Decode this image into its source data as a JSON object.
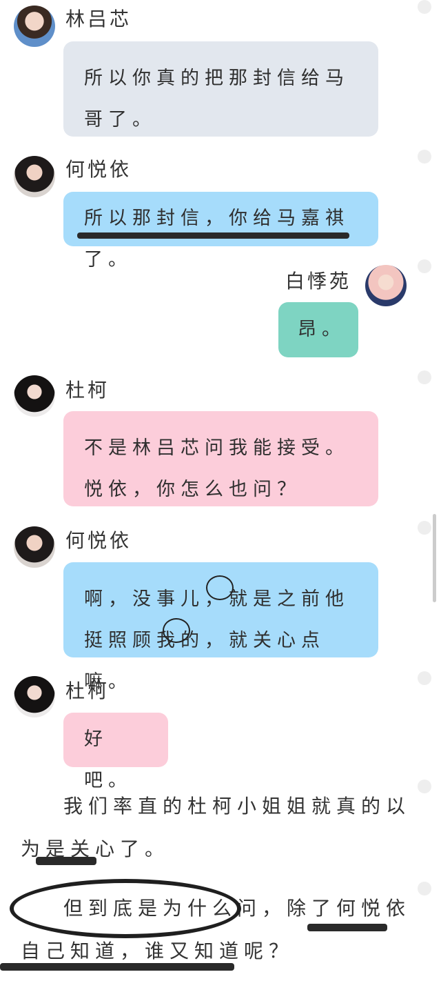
{
  "messages": [
    {
      "name": "林吕芯",
      "text": "所以你真的把那封信给马哥了。",
      "color": "#e2e7ee",
      "avatar": "avatar-icon"
    },
    {
      "name": "何悦依",
      "text": "所以那封信，你给马嘉祺了。",
      "color": "#a6dcfb",
      "avatar": "avatar-icon"
    },
    {
      "name": "白悸苑",
      "text": "昂。",
      "color": "#7ed4c2",
      "avatar": "avatar-icon"
    },
    {
      "name": "杜柯",
      "text": "不是林吕芯问我能接受。悦依，你怎么也问？",
      "color": "#fccdda",
      "avatar": "avatar-icon"
    },
    {
      "name": "何悦依",
      "text": "啊，没事儿，就是之前他挺照顾我的，就关心点嘛。",
      "color": "#a6dcfb",
      "avatar": "avatar-icon"
    },
    {
      "name": "杜柯",
      "text": "好吧。",
      "color": "#fccdda",
      "avatar": "avatar-icon"
    }
  ],
  "narration": [
    "我们率直的杜柯小姐姐就真的以为是关心了。",
    "但到底是为什么问，除了何悦依自己知道，谁又知道呢？"
  ]
}
